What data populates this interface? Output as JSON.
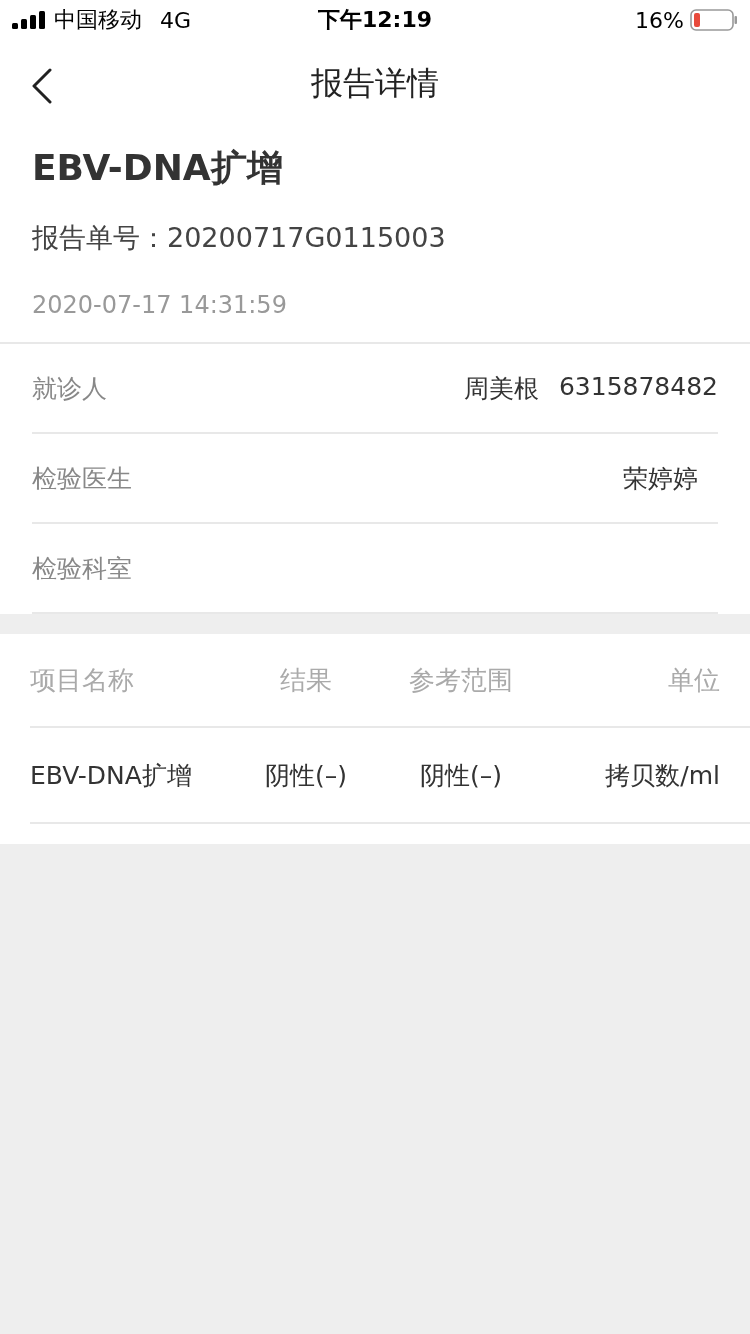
{
  "status_bar": {
    "carrier": "中国移动",
    "network": "4G",
    "time": "下午12:19",
    "battery": "16%"
  },
  "nav": {
    "title": "报告详情"
  },
  "report": {
    "title": "EBV-DNA扩增",
    "number_label": "报告单号：",
    "number": "20200717G0115003",
    "datetime": "2020-07-17 14:31:59"
  },
  "info_rows": [
    {
      "label": "就诊人",
      "values": [
        "周美根",
        "6315878482"
      ]
    },
    {
      "label": "检验医生",
      "values": [
        "荣婷婷"
      ]
    },
    {
      "label": "检验科室",
      "values": []
    }
  ],
  "table": {
    "columns": [
      "项目名称",
      "结果",
      "参考范围",
      "单位"
    ],
    "rows": [
      [
        "EBV-DNA扩增",
        "阴性(–)",
        "阴性(–)",
        "拷贝数/ml"
      ]
    ]
  }
}
